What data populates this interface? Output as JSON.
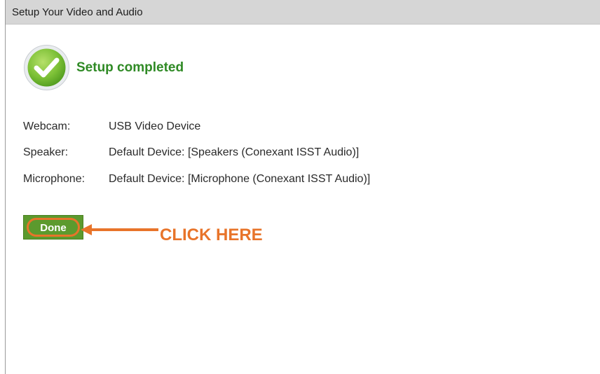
{
  "window": {
    "title": "Setup Your Video and Audio"
  },
  "status": {
    "icon": "check-circle-icon",
    "text": "Setup completed",
    "color": "#2f8a25"
  },
  "devices": [
    {
      "label": "Webcam:",
      "value": "USB Video Device"
    },
    {
      "label": "Speaker:",
      "value": "Default Device: [Speakers (Conexant ISST Audio)]"
    },
    {
      "label": "Microphone:",
      "value": "Default Device: [Microphone (Conexant ISST Audio)]"
    }
  ],
  "actions": {
    "done_label": "Done"
  },
  "annotation": {
    "text": "CLICK HERE",
    "color": "#e8742a"
  }
}
